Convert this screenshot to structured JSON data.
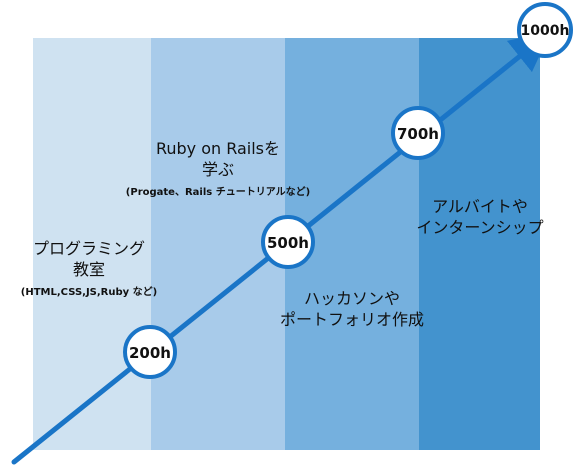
{
  "colors": {
    "band_1": "#cfe2f1",
    "band_2": "#a8cbea",
    "band_3": "#75b0de",
    "band_4": "#4393ce",
    "line": "#1a75c7",
    "milestone_fill": "#ffffff",
    "milestone_border": "#1a75c7"
  },
  "milestones": [
    {
      "label": "200h"
    },
    {
      "label": "500h"
    },
    {
      "label": "700h"
    },
    {
      "label": "1000h"
    }
  ],
  "stages": [
    {
      "title_line1": "プログラミング",
      "title_line2": "教室",
      "note": "(HTML,CSS,JS,Ruby など)"
    },
    {
      "title_line1": "Ruby on Railsを",
      "title_line2": "学ぶ",
      "note": "(Progate、Rails チュートリアルなど)"
    },
    {
      "title_line1": "ハッカソンや",
      "title_line2": "ポートフォリオ作成"
    },
    {
      "title_line1": "アルバイトや",
      "title_line2": "インターンシップ"
    }
  ]
}
